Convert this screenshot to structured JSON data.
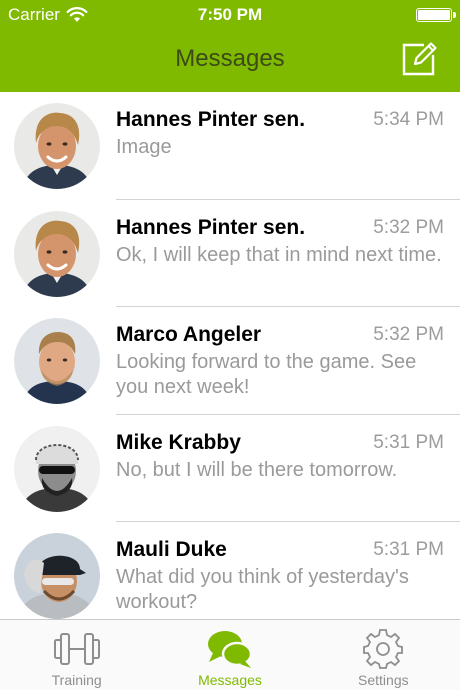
{
  "status_bar": {
    "carrier": "Carrier",
    "time": "7:50 PM",
    "icons": [
      "wifi-icon",
      "battery-icon"
    ]
  },
  "nav": {
    "title": "Messages",
    "compose_icon": "compose-icon"
  },
  "colors": {
    "accent": "#7fba00",
    "title_text": "#3b4a16",
    "secondary_text": "#9a9a9a",
    "separator": "#d3d3d3"
  },
  "messages": [
    {
      "name": "Hannes Pinter sen.",
      "time": "5:34 PM",
      "preview": "Image"
    },
    {
      "name": "Hannes Pinter sen.",
      "time": "5:32 PM",
      "preview": "Ok, I will keep that in mind next time."
    },
    {
      "name": "Marco Angeler",
      "time": "5:32 PM",
      "preview": "Looking forward to the game. See you next week!"
    },
    {
      "name": "Mike Krabby",
      "time": "5:31 PM",
      "preview": "No, but I will be there tomorrow."
    },
    {
      "name": "Mauli Duke",
      "time": "5:31 PM",
      "preview": "What did you think of yesterday's workout?"
    }
  ],
  "tabs": [
    {
      "label": "Training",
      "icon": "dumbbell-icon",
      "active": false
    },
    {
      "label": "Messages",
      "icon": "chat-bubbles-icon",
      "active": true
    },
    {
      "label": "Settings",
      "icon": "gear-icon",
      "active": false
    }
  ]
}
